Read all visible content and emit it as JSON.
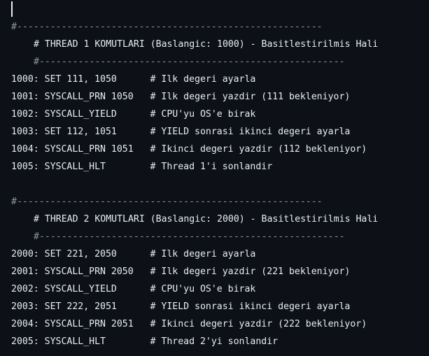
{
  "editor": {
    "blocks": [
      {
        "separator_top": "#-------------------------------------------------------",
        "header": "# THREAD 1 KOMUTLARI (Baslangic: 1000) - Basitlestirilmis Hali",
        "separator_bottom": "#-------------------------------------------------------",
        "lines": [
          {
            "code": "1000: SET 111, 1050      ",
            "comment": "# Ilk degeri ayarla"
          },
          {
            "code": "1001: SYSCALL_PRN 1050   ",
            "comment": "# Ilk degeri yazdir (111 bekleniyor)"
          },
          {
            "code": "1002: SYSCALL_YIELD      ",
            "comment": "# CPU'yu OS'e birak"
          },
          {
            "code": "1003: SET 112, 1051      ",
            "comment": "# YIELD sonrasi ikinci degeri ayarla"
          },
          {
            "code": "1004: SYSCALL_PRN 1051   ",
            "comment": "# Ikinci degeri yazdir (112 bekleniyor)"
          },
          {
            "code": "1005: SYSCALL_HLT        ",
            "comment": "# Thread 1'i sonlandir"
          }
        ]
      },
      {
        "separator_top": "#-------------------------------------------------------",
        "header": "# THREAD 2 KOMUTLARI (Baslangic: 2000) - Basitlestirilmis Hali",
        "separator_bottom": "#-------------------------------------------------------",
        "lines": [
          {
            "code": "2000: SET 221, 2050      ",
            "comment": "# Ilk degeri ayarla"
          },
          {
            "code": "2001: SYSCALL_PRN 2050   ",
            "comment": "# Ilk degeri yazdir (221 bekleniyor)"
          },
          {
            "code": "2002: SYSCALL_YIELD      ",
            "comment": "# CPU'yu OS'e birak"
          },
          {
            "code": "2003: SET 222, 2051      ",
            "comment": "# YIELD sonrasi ikinci degeri ayarla"
          },
          {
            "code": "2004: SYSCALL_PRN 2051   ",
            "comment": "# Ikinci degeri yazdir (222 bekleniyor)"
          },
          {
            "code": "2005: SYSCALL_HLT        ",
            "comment": "# Thread 2'yi sonlandir"
          }
        ]
      }
    ]
  },
  "colors": {
    "background": "#0d1117",
    "text": "#e6edf3",
    "separator": "#8b949e"
  }
}
